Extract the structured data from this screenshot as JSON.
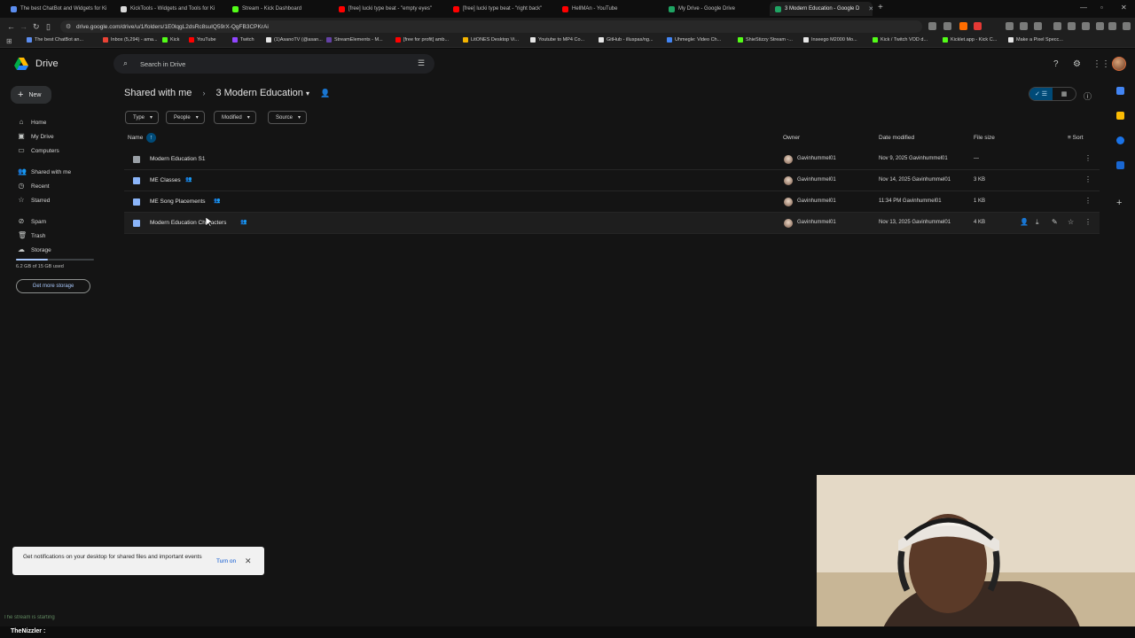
{
  "browser": {
    "tabs": [
      {
        "title": "The best ChatBot and Widgets for Ki",
        "color": "#5b8def",
        "active": false
      },
      {
        "title": "KickTools - Widgets and Tools for Ki",
        "color": "#d9d9d9",
        "active": false
      },
      {
        "title": "Stream - Kick Dashboard",
        "color": "#53fc18",
        "active": false
      },
      {
        "title": "[free] lucki type beat - \"empty eyes\"",
        "color": "#ff0000",
        "active": false
      },
      {
        "title": "[free] lucki type beat - \"right back\"",
        "color": "#ff0000",
        "active": false
      },
      {
        "title": "HellMAn - YouTube",
        "color": "#ff0000",
        "active": false
      },
      {
        "title": "My Drive - Google Drive",
        "color": "#1fa463",
        "active": false
      },
      {
        "title": "3 Modern Education - Google D",
        "color": "#1fa463",
        "active": true
      }
    ],
    "url": "drive.google.com/drive/u/1/folders/1E0lqgL2dsRc8suIQ59rX-QgFB3CPKrAi",
    "bookmarks": [
      {
        "label": "The best ChatBot an...",
        "color": "#5b8def"
      },
      {
        "label": "Inbox (5,294) - ama...",
        "color": "#ea4335"
      },
      {
        "label": "Kick",
        "color": "#53fc18"
      },
      {
        "label": "YouTube",
        "color": "#ff0000"
      },
      {
        "label": "Twitch",
        "color": "#9146ff"
      },
      {
        "label": "(1)AsanoTV (@asan...",
        "color": "#e6e6e6"
      },
      {
        "label": "StreamElements - M...",
        "color": "#6441a5"
      },
      {
        "label": "[free for profit] amb...",
        "color": "#ff0000"
      },
      {
        "label": "LitONES Desktop Vi...",
        "color": "#f4b400"
      },
      {
        "label": "Youtube to MP4 Co...",
        "color": "#e6e6e6"
      },
      {
        "label": "GitHub - illuspas/ng...",
        "color": "#e6e6e6"
      },
      {
        "label": "Uhmegle: Video Ch...",
        "color": "#4285f4"
      },
      {
        "label": "ShieStizzy Stream -...",
        "color": "#53fc18"
      },
      {
        "label": "Inseego M2000 Mo...",
        "color": "#e6e6e6"
      },
      {
        "label": "Kick / Twitch VOD d...",
        "color": "#53fc18"
      },
      {
        "label": "Kicklet.app - Kick C...",
        "color": "#53fc18"
      },
      {
        "label": "Make a Pixel Specc...",
        "color": "#e6e6e6"
      }
    ]
  },
  "drive": {
    "brand": "Drive",
    "search_placeholder": "Search in Drive",
    "new_label": "New",
    "sidebar": [
      {
        "label": "Home",
        "icon": "home-icon",
        "glyph": "⌂"
      },
      {
        "label": "My Drive",
        "icon": "my-drive-icon",
        "glyph": "▣"
      },
      {
        "label": "Computers",
        "icon": "computer-icon",
        "glyph": "▭"
      },
      {
        "label": "Shared with me",
        "icon": "people-icon",
        "glyph": "👥"
      },
      {
        "label": "Recent",
        "icon": "clock-icon",
        "glyph": "◷"
      },
      {
        "label": "Starred",
        "icon": "star-icon",
        "glyph": "☆"
      },
      {
        "label": "Spam",
        "icon": "spam-icon",
        "glyph": "⊘"
      },
      {
        "label": "Trash",
        "icon": "trash-icon",
        "glyph": "🗑"
      },
      {
        "label": "Storage",
        "icon": "cloud-icon",
        "glyph": "☁"
      }
    ],
    "storage": {
      "text": "6.2 GB of 15 GB used",
      "fraction": 0.41,
      "button": "Get more storage"
    },
    "breadcrumb": {
      "parent": "Shared with me",
      "current": "3 Modern Education"
    },
    "filters": [
      "Type",
      "People",
      "Modified",
      "Source"
    ],
    "columns": {
      "name": "Name",
      "owner": "Owner",
      "date": "Date modified",
      "size": "File size",
      "sort": "Sort"
    },
    "files": [
      {
        "name": "Modern Education S1",
        "type": "folder",
        "shared": false,
        "owner": "Gavinhummel01",
        "date": "Nov 9, 2025 Gavinhummel01",
        "size": "—"
      },
      {
        "name": "ME Classes",
        "type": "doc",
        "shared": true,
        "owner": "Gavinhummel01",
        "date": "Nov 14, 2025 Gavinhummel01",
        "size": "3 KB"
      },
      {
        "name": "ME Song Placements",
        "type": "doc",
        "shared": true,
        "owner": "Gavinhummel01",
        "date": "11:34 PM Gavinhummel01",
        "size": "1 KB"
      },
      {
        "name": "Modern Education Characters",
        "type": "doc",
        "shared": true,
        "owner": "Gavinhummel01",
        "date": "Nov 13, 2025 Gavinhummel01",
        "size": "4 KB"
      }
    ],
    "toast": {
      "text": "Get notifications on your desktop for shared files and important events",
      "action": "Turn on"
    }
  },
  "stream": {
    "username": "TheNizzler :",
    "overlay": "The stream is starting"
  }
}
